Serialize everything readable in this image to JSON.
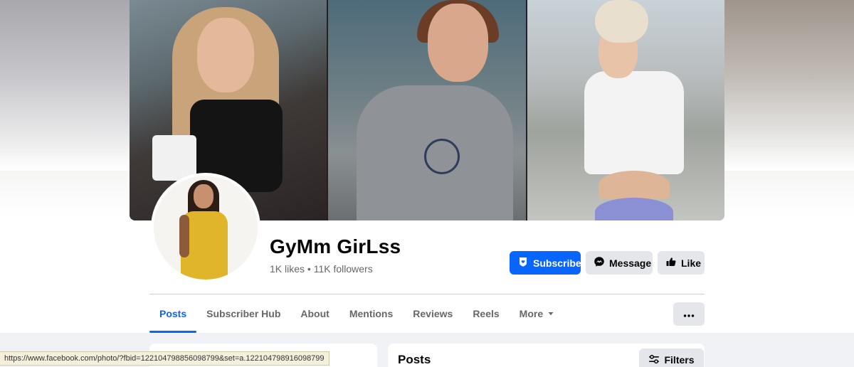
{
  "page": {
    "name": "GyMm GirLss",
    "stats": "1K likes • 11K followers"
  },
  "actions": {
    "subscribe_label": "Subscribe",
    "message_label": "Message",
    "like_label": "Like"
  },
  "tabs": [
    {
      "label": "Posts",
      "active": true
    },
    {
      "label": "Subscriber Hub",
      "active": false
    },
    {
      "label": "About",
      "active": false
    },
    {
      "label": "Mentions",
      "active": false
    },
    {
      "label": "Reviews",
      "active": false
    },
    {
      "label": "Reels",
      "active": false
    },
    {
      "label": "More",
      "active": false
    }
  ],
  "posts_section": {
    "title": "Posts",
    "filters_label": "Filters"
  },
  "status_bar": {
    "url": "https://www.facebook.com/photo/?fbid=122104798856098799&set=a.122104798916098799"
  },
  "colors": {
    "accent": "#0866ff",
    "secondary_button": "#e4e6eb",
    "muted_text": "#65676b"
  },
  "icons": {
    "subscribe": "shield-heart-icon",
    "message": "messenger-icon",
    "like": "thumbs-up-icon",
    "more_tab": "caret-down-icon",
    "overflow": "ellipsis-icon",
    "filters": "sliders-icon"
  }
}
